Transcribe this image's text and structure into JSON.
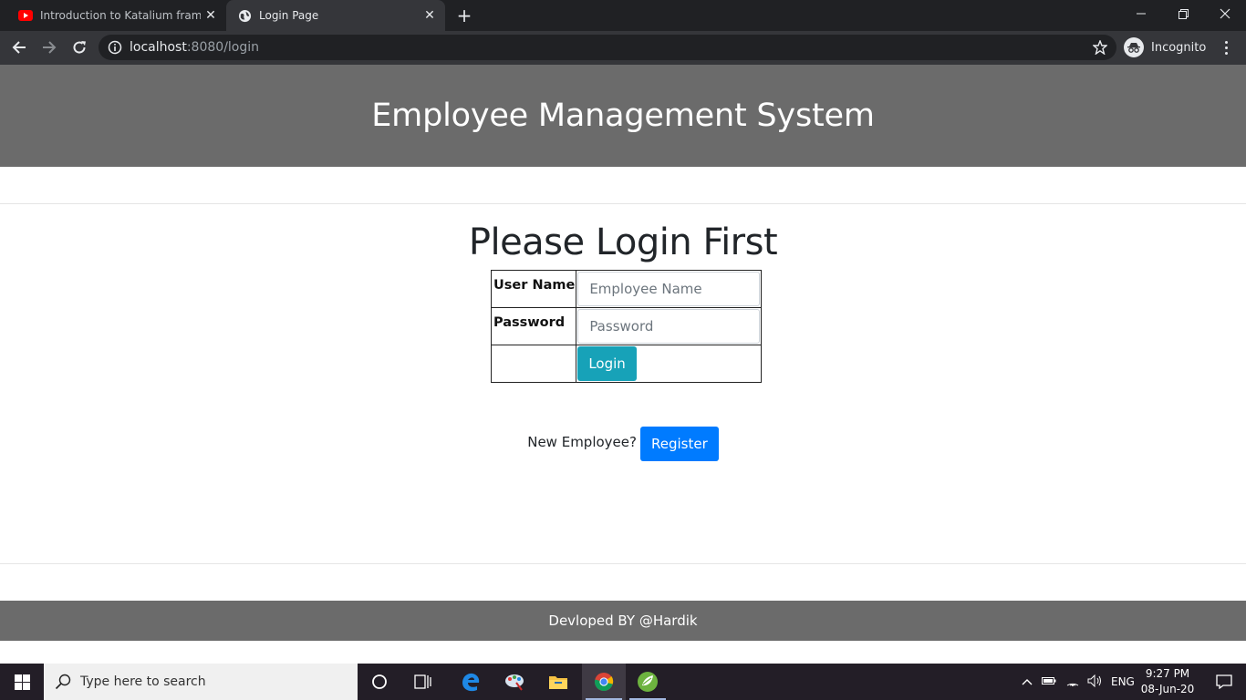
{
  "browser": {
    "tabs": [
      {
        "title": "Introduction to Katalium framework",
        "favicon": "youtube-icon",
        "active": false
      },
      {
        "title": "Login Page",
        "favicon": "globe-icon",
        "active": true
      }
    ],
    "url_host": "localhost",
    "url_rest": ":8080/login",
    "profile_label": "Incognito"
  },
  "page": {
    "header_title": "Employee Management System",
    "login_title": "Please Login First",
    "form": {
      "username_label": "User Name",
      "username_placeholder": "Employee Name",
      "password_label": "Password",
      "password_placeholder": "Password",
      "login_button": "Login"
    },
    "register": {
      "question": "New Employee?",
      "button": "Register"
    },
    "footer_text": "Devloped BY @Hardik"
  },
  "taskbar": {
    "search_placeholder": "Type here to search",
    "language": "ENG",
    "time": "9:27 PM",
    "date": "08-Jun-20"
  },
  "colors": {
    "header_bg": "#6b6b6b",
    "login_button": "#17a2b8",
    "register_button": "#007bff"
  }
}
